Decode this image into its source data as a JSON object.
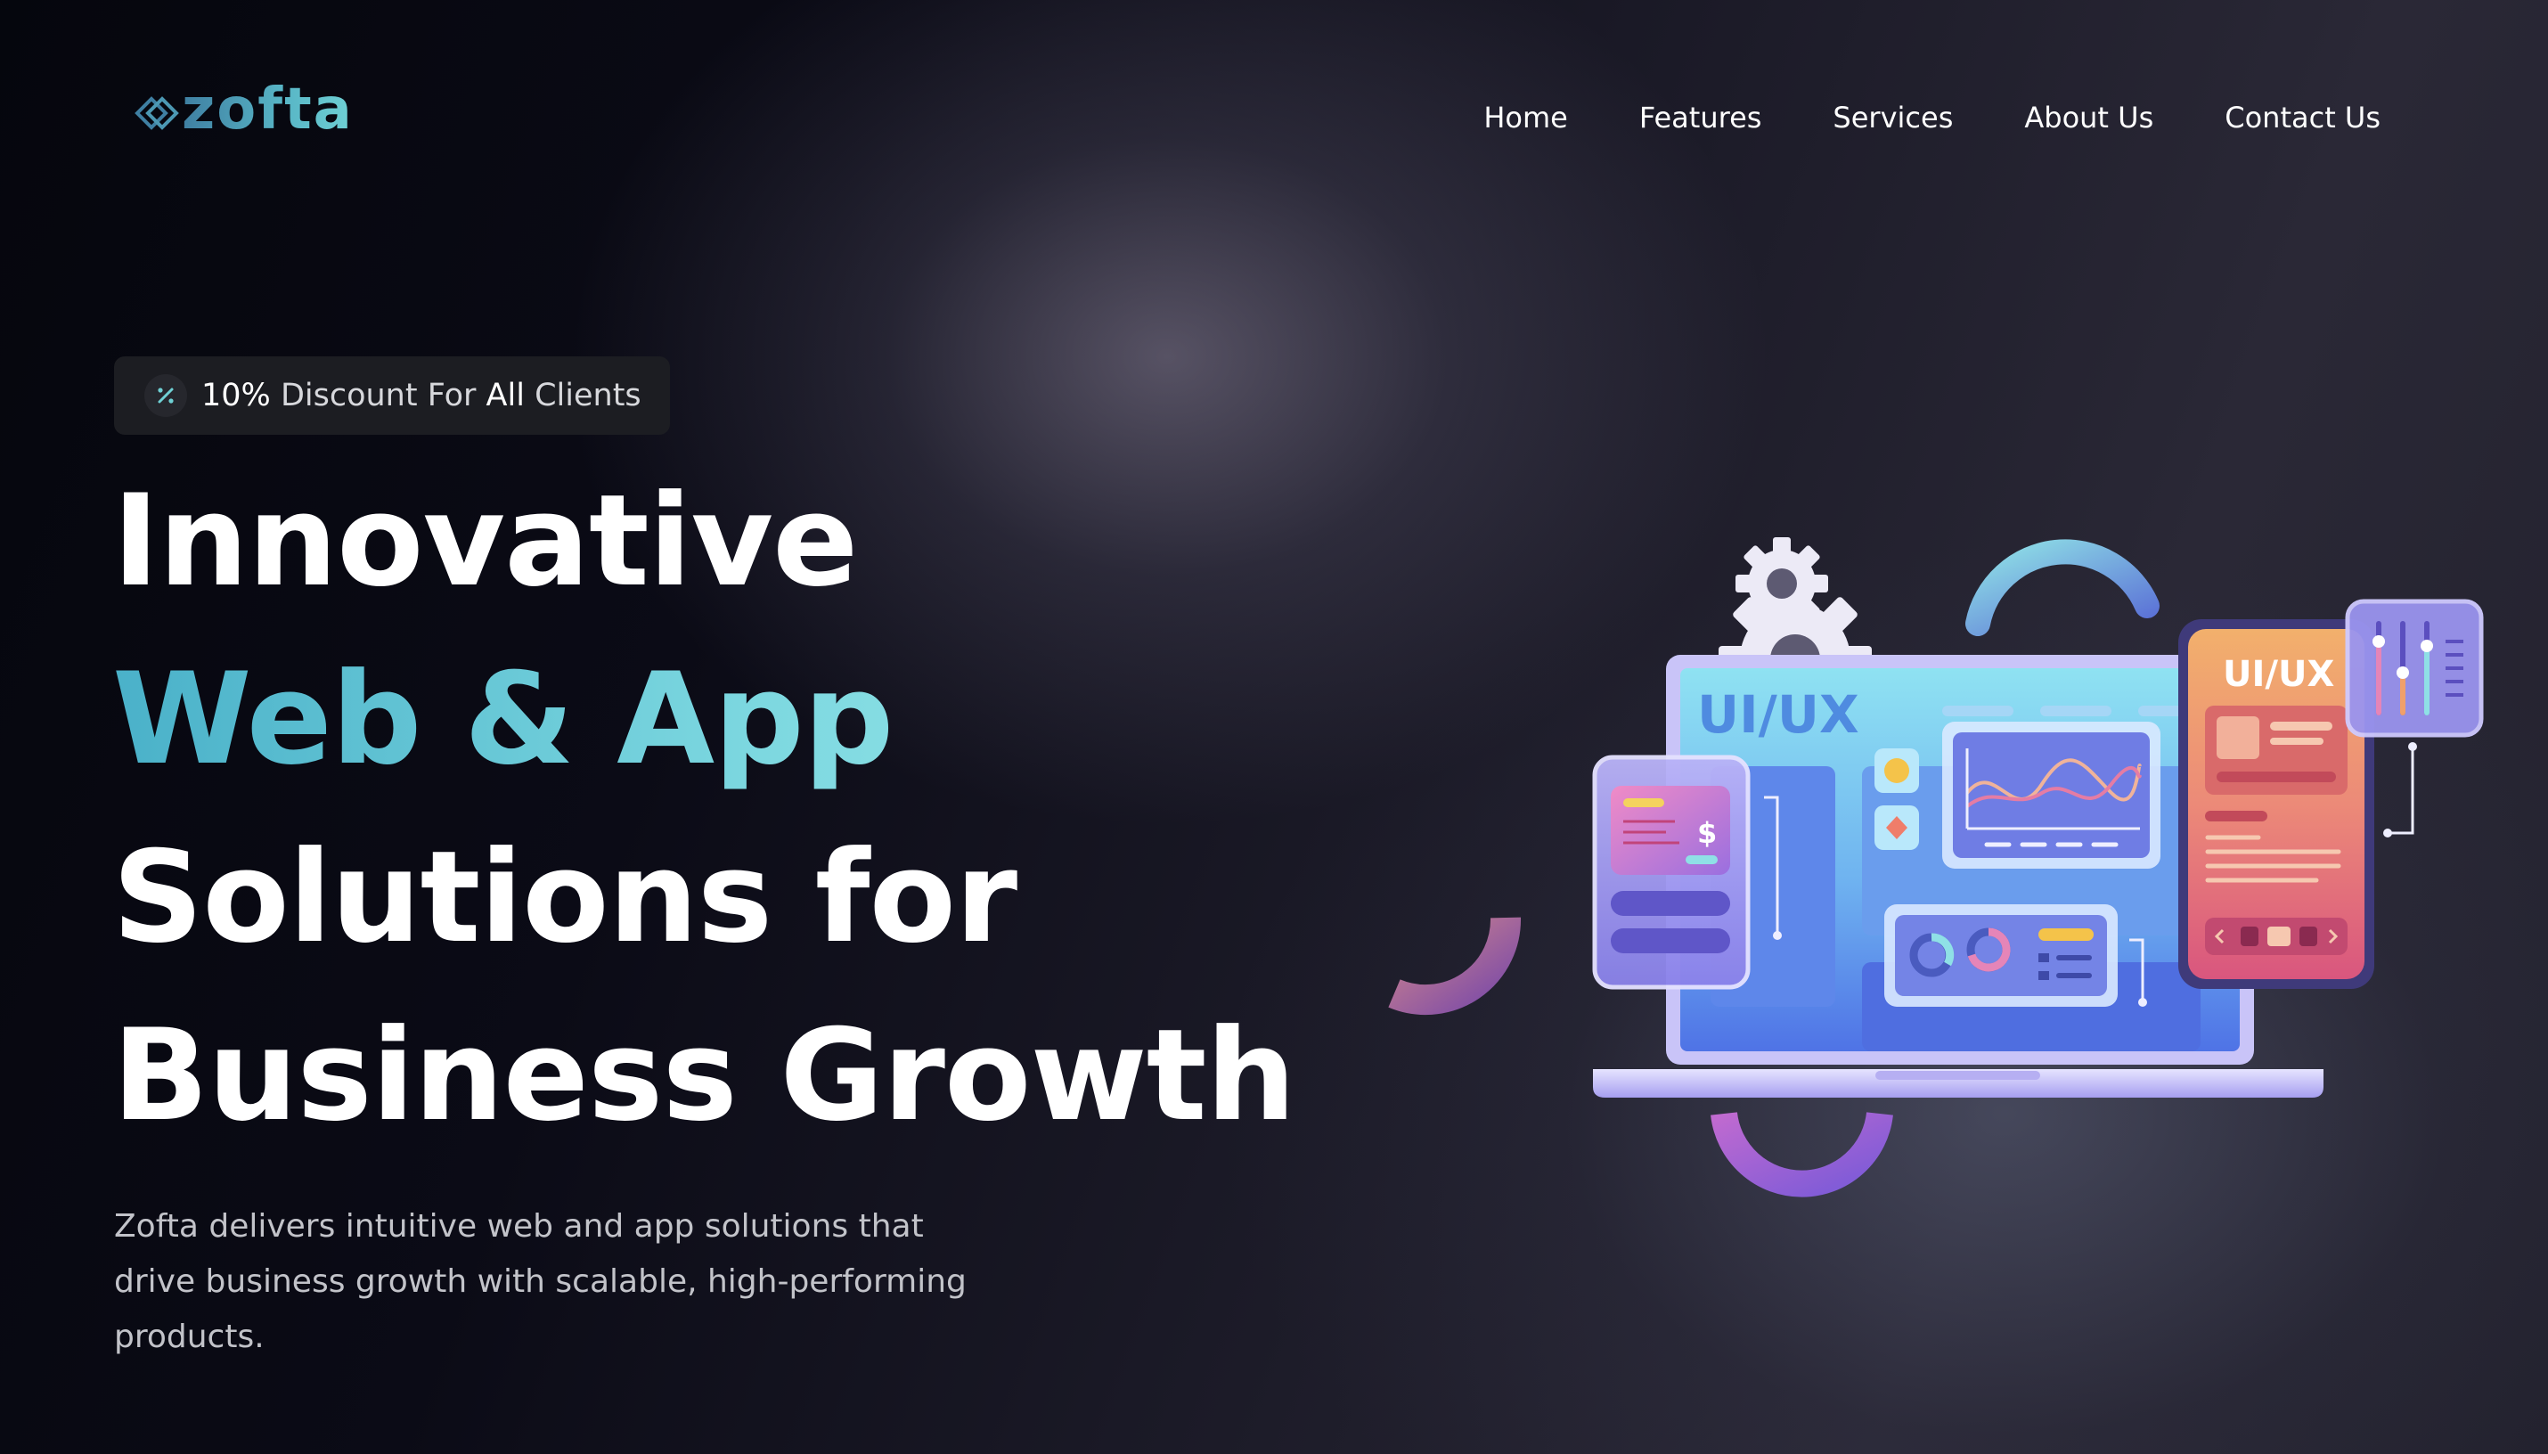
{
  "header": {
    "logo_text": "zofta",
    "nav": [
      {
        "label": "Home"
      },
      {
        "label": "Features"
      },
      {
        "label": "Services"
      },
      {
        "label": "About Us"
      },
      {
        "label": "Contact Us"
      }
    ]
  },
  "badge": {
    "icon": "percent-icon",
    "percent": "10%",
    "text_1": "Discount For",
    "emphasis": "All",
    "text_2": "Clients"
  },
  "hero": {
    "title_line_1": "Innovative",
    "title_line_2": "Web & App",
    "title_line_3": "Solutions for",
    "title_line_4": "Business Growth",
    "description": "Zofta delivers intuitive web and app solutions that drive business growth with scalable, high-performing products."
  },
  "illustration": {
    "laptop_label": "UI/UX",
    "phone_label": "UI/UX",
    "currency_symbol": "$"
  },
  "colors": {
    "accent": "#6fd0d4",
    "accent_dark": "#3f7fa2",
    "background": "#0b0b16",
    "text": "#ffffff",
    "muted_text": "#c2c3c9"
  }
}
